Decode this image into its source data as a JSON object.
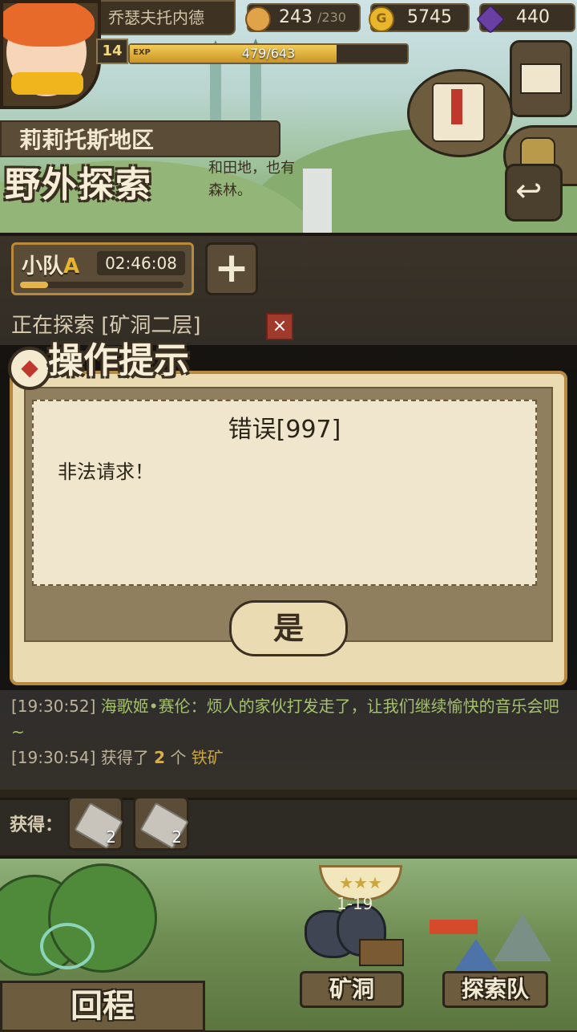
{
  "header": {
    "player_name": "乔瑟夫托内德",
    "level": "14",
    "exp_label": "EXP",
    "exp_text": "479/643",
    "exp_fraction": 0.745,
    "stamina": "243",
    "stamina_max": "/230",
    "gold": "5745",
    "gems": "440",
    "region_name": "莉莉托斯地区",
    "mode_title": "野外探索",
    "region_desc_line1": "和田地，也有",
    "region_desc_line2": "森林。"
  },
  "squad": {
    "name_prefix": "小队",
    "name_letter": "A",
    "timer": "02:46:08",
    "progress_fraction": 0.17,
    "add_label": "+"
  },
  "exploring": {
    "text": "正在探索 [矿洞二层]",
    "cancel_label": "×"
  },
  "dialog": {
    "title": "操作提示",
    "icon_glyph": "◆",
    "error_code": "错误[997]",
    "error_message": "非法请求！",
    "ok_label": "是"
  },
  "log": [
    {
      "time": "[19:30:52]",
      "speaker": "海歌姬•赛伦：",
      "text": "烦人的家伙打发走了，让我们继续愉快的音乐会吧~"
    },
    {
      "time": "[19:30:54]",
      "prefix": "获得了 ",
      "count": "2",
      "mid": " 个 ",
      "item": "铁矿"
    }
  ],
  "obtained": {
    "label": "获得：",
    "items": [
      {
        "count": "2"
      },
      {
        "count": "2"
      }
    ]
  },
  "nav": {
    "return_label": "回程",
    "mine_label": "矿洞",
    "mine_level": "1-19",
    "team_label": "探索队"
  },
  "colors": {
    "accent_gold": "#c9a63e",
    "log_green": "#a5c26a",
    "cancel_red": "#a03a2c"
  }
}
